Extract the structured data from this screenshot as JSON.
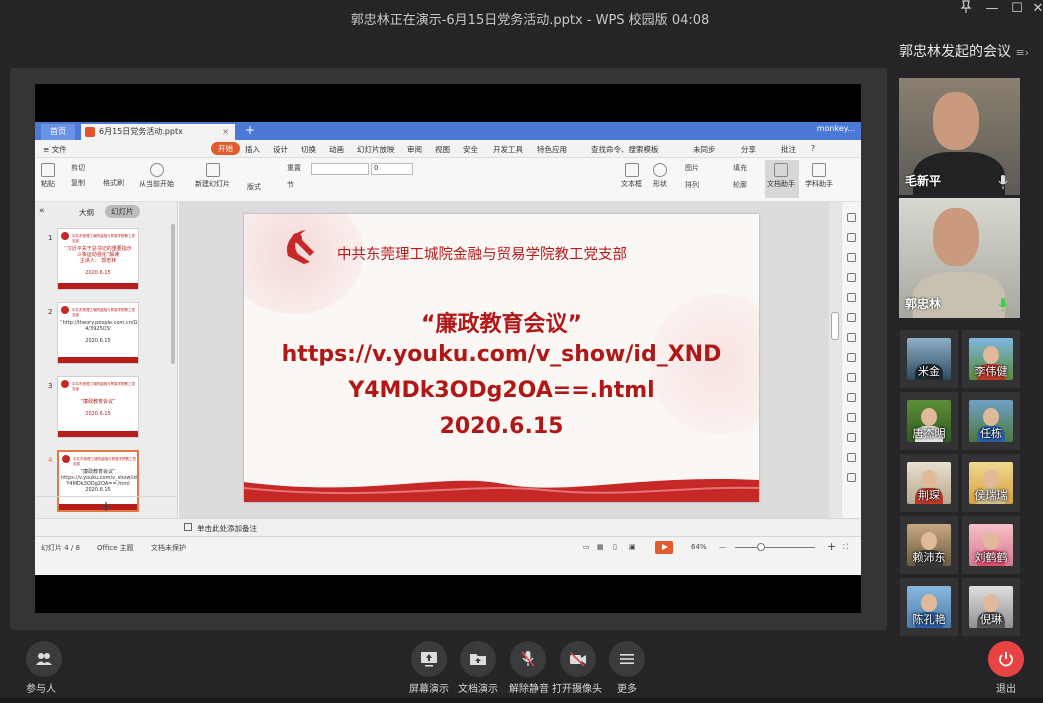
{
  "titlebar": {
    "title": "郭忠林正在演示-6月15日党务活动.pptx - WPS 校园版 04:08",
    "pin_icon": "pin-icon",
    "min_label": "—",
    "max_label": "☐",
    "close_label": "✕"
  },
  "wps": {
    "home_tab": "首页",
    "doc_tab": "6月15日党务活动.pptx",
    "doc_close": "×",
    "new_tab": "+",
    "user": "monkey...",
    "menu": {
      "file": "≡ 文件",
      "start": "开始",
      "items": [
        "插入",
        "设计",
        "切换",
        "动画",
        "幻灯片放映",
        "审阅",
        "视图",
        "安全",
        "开发工具",
        "特色应用"
      ],
      "search": "查找命令、搜索模板",
      "sync": "未同步",
      "share": "分享",
      "comment": "批注",
      "help": "?"
    },
    "ribbon": {
      "paste": "粘贴",
      "cut": "剪切",
      "copy": "复制",
      "format_painter": "格式刷",
      "from_current": "从当前开始",
      "new_slide": "新建幻灯片",
      "layout": "版式",
      "reset": "重置",
      "section": "节",
      "font_size": "0",
      "textbox": "文本框",
      "shape": "形状",
      "picture": "图片",
      "fill": "填充",
      "arrange": "排列",
      "outline": "轮廓",
      "doc_assistant": "文档助手",
      "school_assistant": "学科助手"
    },
    "thumbpane": {
      "outline_tab": "大纲",
      "slides_tab": "幻灯片",
      "collapse": "«",
      "add": "+",
      "slides": [
        {
          "num": "1",
          "lines": "“习近平关于总书记的重要指示\n斗争运动强化”解读\n主讲人：   郭忠林\n\n2020.6.15"
        },
        {
          "num": "2",
          "lines": "“http://theory.people.com.cn/GB/6829\n4/392503/\n\n2020.6.15"
        },
        {
          "num": "3",
          "lines": "“廉政教育会议”\n\n2020.6.15"
        },
        {
          "num": "4",
          "lines": "“廉政教育会议”\nhttps://v.youku.com/v_show/id_XND\nY4MDk3ODg2OA==.html\n2020.6.15"
        }
      ],
      "thumb_header": "中共东莞理工城院金融与贸易学院教工党支部"
    },
    "slide": {
      "org": "中共东莞理工城院金融与贸易学院教工党支部",
      "title": "“廉政教育会议”",
      "url_line1": "https://v.youku.com/v_show/id_XND",
      "url_line2": "Y4MDk3ODg2OA==.html",
      "date": "2020.6.15"
    },
    "notes": "单击此处添加备注",
    "status": {
      "slide_count": "幻灯片 4 / 8",
      "theme": "Office 主题",
      "protect": "文档未保护",
      "zoom": "64%",
      "zoom_minus": "—",
      "zoom_plus": "+"
    }
  },
  "panel": {
    "meeting_title": "郭忠林发起的会议",
    "speakers": [
      {
        "name": "毛新平"
      },
      {
        "name": "郭忠林"
      }
    ],
    "participants": [
      "米金",
      "李伟健",
      "唐杰明",
      "任栋",
      "荆琛",
      "侯瑞瑞",
      "赖沛东",
      "刘鹤鹤",
      "陈孔艳",
      "倪琳"
    ]
  },
  "toolbar": {
    "participants": "参与人",
    "share_screen": "屏幕演示",
    "share_doc": "文档演示",
    "unmute": "解除静音",
    "camera": "打开摄像头",
    "more": "更多",
    "exit": "退出"
  },
  "colors": {
    "accent_red": "#b71c1c",
    "wps_blue": "#4c79d8",
    "wps_orange": "#e25b2f",
    "exit_red": "#e84343"
  }
}
